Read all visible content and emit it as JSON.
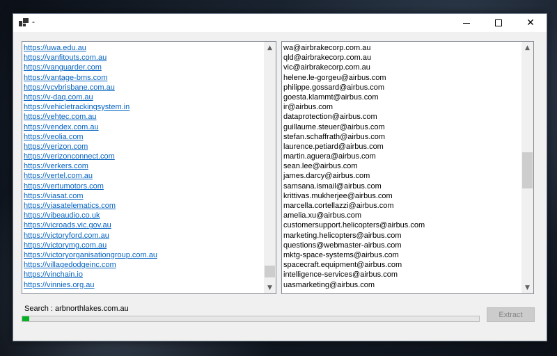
{
  "window": {
    "title": "-"
  },
  "left_list": {
    "items": [
      "https://uwa.edu.au",
      "https://vanfitouts.com.au",
      "https://vanguarder.com",
      "https://vantage-bms.com",
      "https://vcvbrisbane.com.au",
      "https://v-daq.com.au",
      "https://vehicletrackingsystem.in",
      "https://vehtec.com.au",
      "https://vendex.com.au",
      "https://veolia.com",
      "https://verizon.com",
      "https://verizonconnect.com",
      "https://verkers.com",
      "https://vertel.com.au",
      "https://vertumotors.com",
      "https://viasat.com",
      "https://viasatelematics.com",
      "https://vibeaudio.co.uk",
      "https://vicroads.vic.gov.au",
      "https://victoryford.com.au",
      "https://victorymg.com.au",
      "https://victoryorganisationgroup.com.au",
      "https://villagedodgeinc.com",
      "https://vinchain.io",
      "https://vinnies.org.au"
    ]
  },
  "right_list": {
    "items": [
      "wa@airbrakecorp.com.au",
      "qld@airbrakecorp.com.au",
      "vic@airbrakecorp.com.au",
      "helene.le-gorgeu@airbus.com",
      "philippe.gossard@airbus.com",
      "goesta.klammt@airbus.com",
      "ir@airbus.com",
      "dataprotection@airbus.com",
      "guillaume.steuer@airbus.com",
      "stefan.schaffrath@airbus.com",
      "laurence.petiard@airbus.com",
      "martin.aguera@airbus.com",
      "sean.lee@airbus.com",
      "james.darcy@airbus.com",
      "samsana.ismail@airbus.com",
      "krittivas.mukherjee@airbus.com",
      "marcella.cortellazzi@airbus.com",
      "amelia.xu@airbus.com",
      "customersupport.helicopters@airbus.com",
      "marketing.helicopters@airbus.com",
      "questions@webmaster-airbus.com",
      "mktg-space-systems@airbus.com",
      "spacecraft.equipment@airbus.com",
      "intelligence-services@airbus.com",
      "uasmarketing@airbus.com"
    ]
  },
  "search": {
    "label": "Search :",
    "value": "arbnorthlakes.com.au"
  },
  "progress": {
    "fraction": 0.015,
    "color": "#06b025"
  },
  "extract_button": {
    "label": "Extract"
  }
}
